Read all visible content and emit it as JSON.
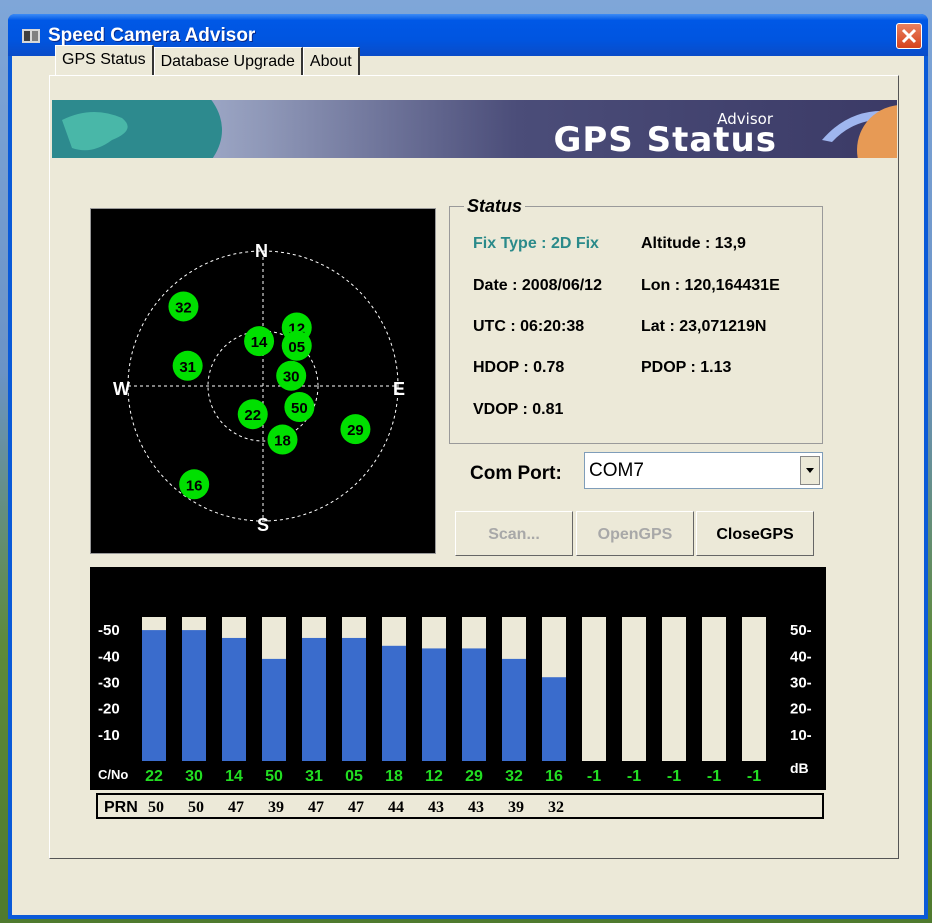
{
  "window": {
    "title": "Speed Camera Advisor"
  },
  "tabs": [
    {
      "label": "GPS Status"
    },
    {
      "label": "Database Upgrade"
    },
    {
      "label": "About"
    }
  ],
  "banner": {
    "title": "GPS Status",
    "subtitle": "Advisor"
  },
  "sky": {
    "north": "N",
    "south": "S",
    "east": "E",
    "west": "W",
    "satellites": [
      {
        "prn": "32",
        "azimuth": 315,
        "elevation": 15
      },
      {
        "prn": "12",
        "azimuth": 30,
        "elevation": 45
      },
      {
        "prn": "05",
        "azimuth": 40,
        "elevation": 55
      },
      {
        "prn": "14",
        "azimuth": 355,
        "elevation": 60
      },
      {
        "prn": "30",
        "azimuth": 70,
        "elevation": 70
      },
      {
        "prn": "31",
        "azimuth": 285,
        "elevation": 38
      },
      {
        "prn": "22",
        "azimuth": 200,
        "elevation": 70
      },
      {
        "prn": "50",
        "azimuth": 120,
        "elevation": 62
      },
      {
        "prn": "29",
        "azimuth": 115,
        "elevation": 22
      },
      {
        "prn": "18",
        "azimuth": 160,
        "elevation": 52
      },
      {
        "prn": "16",
        "azimuth": 215,
        "elevation": 10
      }
    ]
  },
  "status": {
    "legend": "Status",
    "fix_type": "Fix Type : 2D Fix",
    "altitude": "Altitude : 13,9",
    "date": "Date : 2008/06/12",
    "lon": "Lon : 120,164431E",
    "utc": "UTC : 06:20:38",
    "lat": "Lat : 23,071219N",
    "hdop": "HDOP : 0.78",
    "pdop": "PDOP : 1.13",
    "vdop": "VDOP : 0.81"
  },
  "comport": {
    "label": "Com Port:",
    "value": "COM7"
  },
  "buttons": {
    "scan": "Scan...",
    "open": "OpenGPS",
    "close": "CloseGPS"
  },
  "chart_data": {
    "type": "bar",
    "ylabel_left": "C/No",
    "ylabel_right": "dB",
    "yticks": [
      "-50",
      "-40",
      "-30",
      "-20",
      "-10"
    ],
    "yticks_right": [
      "50-",
      "40-",
      "30-",
      "20-",
      "10-"
    ],
    "ylim": [
      0,
      55
    ],
    "prn": [
      "22",
      "30",
      "14",
      "50",
      "31",
      "05",
      "18",
      "12",
      "29",
      "32",
      "16",
      "-1",
      "-1",
      "-1",
      "-1",
      "-1"
    ],
    "values": [
      50,
      50,
      47,
      39,
      47,
      47,
      44,
      43,
      43,
      39,
      32,
      0,
      0,
      0,
      0,
      0
    ],
    "prn_label": "PRN",
    "snr_labels": [
      "50",
      "50",
      "47",
      "39",
      "47",
      "47",
      "44",
      "43",
      "43",
      "39",
      "32"
    ],
    "colors": {
      "bar": "#3a6ccc",
      "bar_bg": "#ece9d8",
      "prn_text": "#22dd22"
    }
  }
}
